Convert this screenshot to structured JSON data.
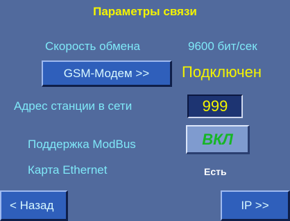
{
  "title": "Параметры связи",
  "exchange_speed": {
    "label": "Скорость обмена",
    "value": "9600 бит/сек"
  },
  "modem": {
    "button_label": "GSM-Модем >>",
    "status": "Подключен"
  },
  "station_address": {
    "label": "Адрес станции в сети",
    "value": "999"
  },
  "modbus": {
    "label": "Поддержка ModBus",
    "toggle_label": "ВКЛ"
  },
  "ethernet": {
    "label": "Карта Ethernet",
    "value": "Есть"
  },
  "nav": {
    "back_label": "< Назад",
    "next_label": "IP >>"
  },
  "colors": {
    "background": "#516a9d",
    "title_yellow": "#f4f400",
    "label_cyan": "#7fe8f8",
    "button_blue": "#2f5fbb",
    "toggle_green": "#16b626"
  }
}
